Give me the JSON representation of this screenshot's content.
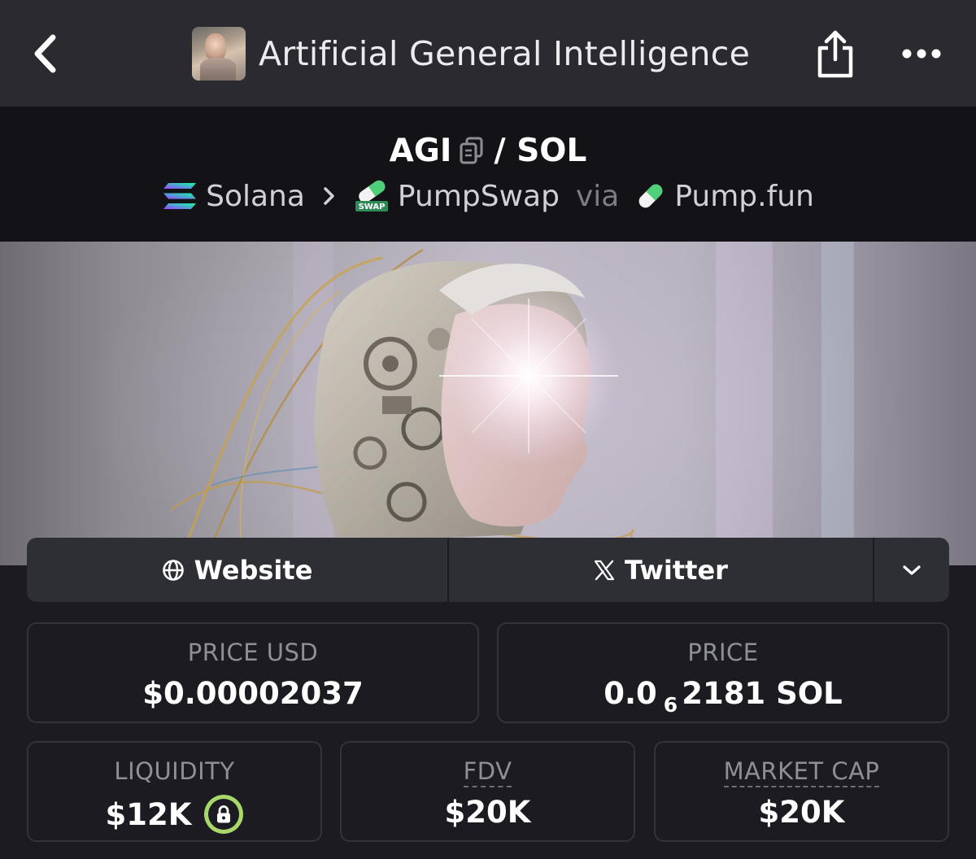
{
  "header": {
    "title": "Artificial General Intelligence",
    "back_icon": "chevron-left-icon",
    "share_icon": "share-icon",
    "more_icon": "more-horizontal-icon"
  },
  "pair": {
    "base": "AGI",
    "separator": "/ SOL",
    "copy_icon": "copy-icon"
  },
  "path": {
    "chain": "Solana",
    "chevron": ">",
    "dex": "PumpSwap",
    "dex_badge": "SWAP",
    "via": "via",
    "launchpad": "Pump.fun"
  },
  "links": {
    "website": "Website",
    "twitter": "Twitter",
    "expand_icon": "chevron-down-icon"
  },
  "stats": {
    "price_usd": {
      "label": "PRICE USD",
      "value": "$0.00002037"
    },
    "price": {
      "label": "PRICE",
      "prefix": "0.0",
      "zeros": "6",
      "suffix": "2181 SOL"
    },
    "liquidity": {
      "label": "LIQUIDITY",
      "value": "$12K"
    },
    "fdv": {
      "label": "FDV",
      "value": "$20K"
    },
    "market_cap": {
      "label": "MARKET CAP",
      "value": "$20K"
    }
  },
  "colors": {
    "background": "#1b1b21",
    "topbar": "#2a2a30",
    "pair_header": "#131317",
    "card_border": "#33333b",
    "lock_green": "#a8d86a"
  }
}
